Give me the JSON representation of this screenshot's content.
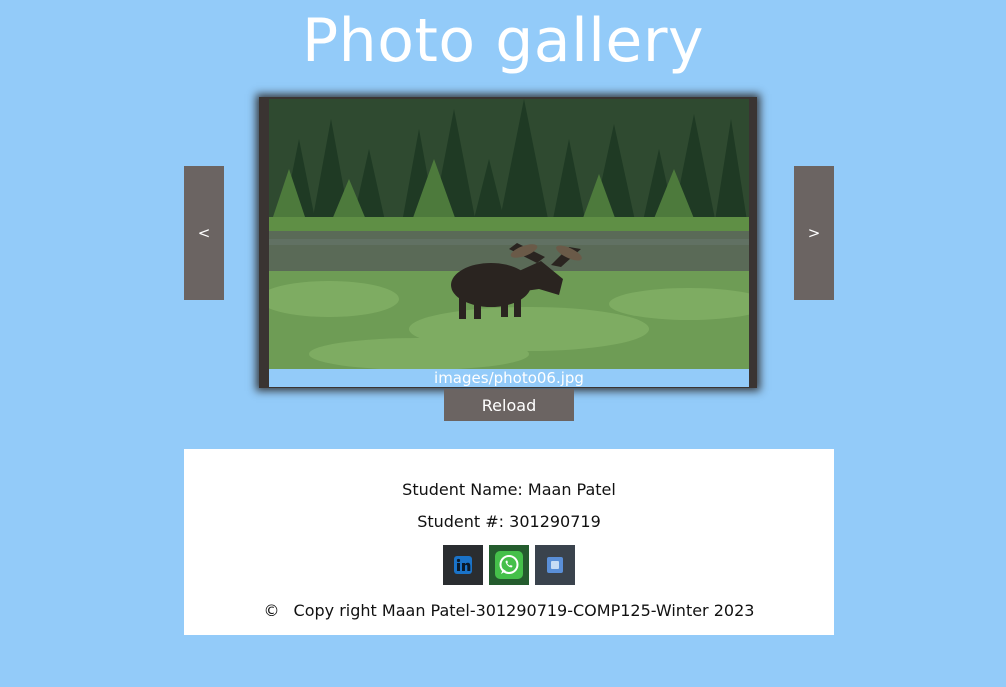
{
  "header": {
    "title": "Photo gallery"
  },
  "gallery": {
    "prev_label": "<",
    "next_label": ">",
    "caption": "images/photo06.jpg",
    "reload_label": "Reload"
  },
  "footer": {
    "student_name": "Student Name: Maan Patel",
    "student_number": "Student #: 301290719",
    "social_icons": [
      "linkedin-icon",
      "whatsapp-icon",
      "messenger-icon"
    ],
    "copyright_symbol": "©",
    "copyright_text": "Copy right Maan Patel-301290719-COMP125-Winter 2023"
  },
  "colors": {
    "background": "#93cbf9",
    "button": "#6b6462",
    "footer_bg": "#ffffff"
  }
}
